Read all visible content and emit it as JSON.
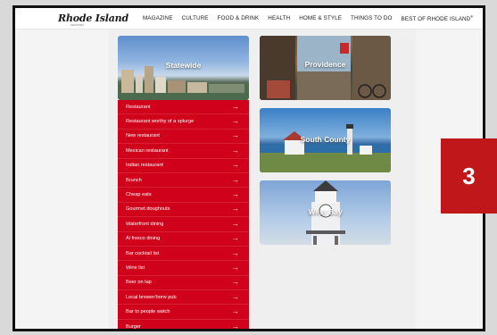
{
  "site": {
    "logo": "Rhode Island",
    "tagline": "MONTHLY"
  },
  "nav": {
    "items": [
      "MAGAZINE",
      "CULTURE",
      "FOOD & DRINK",
      "HEALTH",
      "HOME & STYLE",
      "THINGS TO DO",
      "BEST OF RHODE ISLAND"
    ],
    "registered_mark": "®"
  },
  "tiles": {
    "statewide": "Statewide",
    "providence": "Providence",
    "south_county": "South County",
    "west_bay": "West Bay"
  },
  "categories": [
    {
      "label": "Restaurant",
      "arrow": "→"
    },
    {
      "label": "Restaurant worthy of a splurge",
      "arrow": "→"
    },
    {
      "label": "New restaurant",
      "arrow": "→"
    },
    {
      "label": "Mexican restaurant",
      "arrow": "→"
    },
    {
      "label": "Indian restaurant",
      "arrow": "→"
    },
    {
      "label": "Brunch",
      "arrow": "→"
    },
    {
      "label": "Cheap eats",
      "arrow": "→"
    },
    {
      "label": "Gourmet doughnuts",
      "arrow": "→"
    },
    {
      "label": "Waterfront dining",
      "arrow": "→"
    },
    {
      "label": "Al fresco dining",
      "arrow": "→"
    },
    {
      "label": "Bar cocktail list",
      "arrow": "→"
    },
    {
      "label": "Wine list",
      "arrow": "→"
    },
    {
      "label": "Beer on tap",
      "arrow": "→"
    },
    {
      "label": "Local brewer/brew pub",
      "arrow": "→"
    },
    {
      "label": "Bar to people watch",
      "arrow": "→"
    },
    {
      "label": "Burger",
      "arrow": "→"
    }
  ],
  "badge": {
    "number": "3"
  },
  "colors": {
    "accent": "#d0021b",
    "badge": "#c0171b"
  }
}
